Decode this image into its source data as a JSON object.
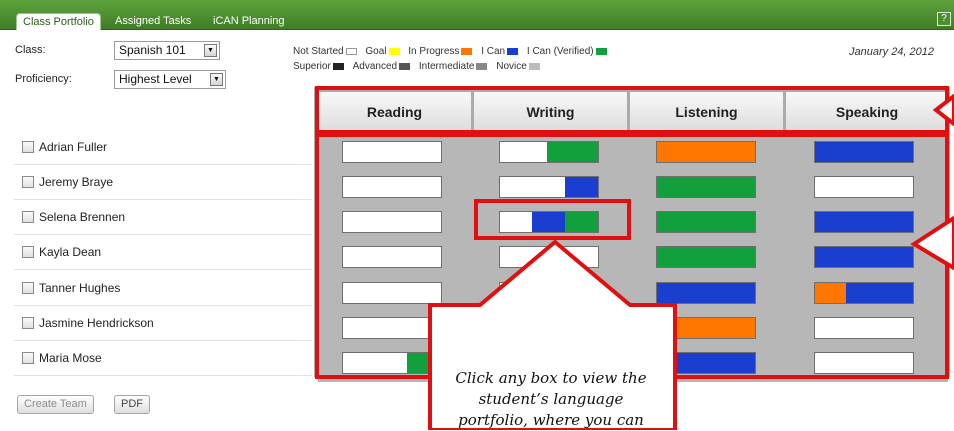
{
  "tabs": [
    {
      "label": "Class Portfolio",
      "active": true
    },
    {
      "label": "Assigned Tasks",
      "active": false
    },
    {
      "label": "iCAN Planning",
      "active": false
    }
  ],
  "help_label": "?",
  "filters": {
    "class_label": "Class:",
    "class_value": "Spanish 101",
    "proficiency_label": "Proficiency:",
    "proficiency_value": "Highest Level"
  },
  "legend": {
    "status": [
      {
        "label": "Not Started",
        "color": "#ffffff"
      },
      {
        "label": "Goal",
        "color": "#ffff00"
      },
      {
        "label": "In Progress",
        "color": "#ff7700"
      },
      {
        "label": "I Can",
        "color": "#1a3fd0"
      },
      {
        "label": "I Can (Verified)",
        "color": "#12a03c"
      }
    ],
    "level": [
      {
        "label": "Superior",
        "color": "#222222"
      },
      {
        "label": "Advanced",
        "color": "#555555"
      },
      {
        "label": "Intermediate",
        "color": "#888888"
      },
      {
        "label": "Novice",
        "color": "#bbbbbb"
      }
    ]
  },
  "date": "January 24, 2012",
  "columns": [
    "Reading",
    "Writing",
    "Listening",
    "Speaking"
  ],
  "students": [
    {
      "name": "Adrian Fuller",
      "cells": [
        [
          {
            "status": "Not Started",
            "fraction": 1
          }
        ],
        [
          {
            "status": "Not Started",
            "fraction": 0.48
          },
          {
            "status": "I Can (Verified)",
            "fraction": 0.52
          }
        ],
        [
          {
            "status": "In Progress",
            "fraction": 1
          }
        ],
        [
          {
            "status": "I Can",
            "fraction": 1
          }
        ]
      ]
    },
    {
      "name": "Jeremy Braye",
      "cells": [
        [
          {
            "status": "Not Started",
            "fraction": 1
          }
        ],
        [
          {
            "status": "Not Started",
            "fraction": 0.66
          },
          {
            "status": "I Can",
            "fraction": 0.34
          }
        ],
        [
          {
            "status": "I Can (Verified)",
            "fraction": 1
          }
        ],
        [
          {
            "status": "Not Started",
            "fraction": 1
          }
        ]
      ]
    },
    {
      "name": "Selena Brennen",
      "cells": [
        [
          {
            "status": "Not Started",
            "fraction": 1
          }
        ],
        [
          {
            "status": "Not Started",
            "fraction": 0.33
          },
          {
            "status": "I Can",
            "fraction": 0.33
          },
          {
            "status": "I Can (Verified)",
            "fraction": 0.34
          }
        ],
        [
          {
            "status": "I Can (Verified)",
            "fraction": 1
          }
        ],
        [
          {
            "status": "I Can",
            "fraction": 1
          }
        ]
      ]
    },
    {
      "name": "Kayla Dean",
      "cells": [
        [
          {
            "status": "Not Started",
            "fraction": 1
          }
        ],
        [
          {
            "status": "Not Started",
            "fraction": 1
          }
        ],
        [
          {
            "status": "I Can (Verified)",
            "fraction": 1
          }
        ],
        [
          {
            "status": "I Can",
            "fraction": 1
          }
        ]
      ]
    },
    {
      "name": "Tanner Hughes",
      "cells": [
        [
          {
            "status": "Not Started",
            "fraction": 1
          }
        ],
        [
          {
            "status": "Not Started",
            "fraction": 1
          }
        ],
        [
          {
            "status": "I Can",
            "fraction": 1
          }
        ],
        [
          {
            "status": "In Progress",
            "fraction": 0.32
          },
          {
            "status": "I Can",
            "fraction": 0.68
          }
        ]
      ]
    },
    {
      "name": "Jasmine Hendrickson",
      "cells": [
        [
          {
            "status": "Not Started",
            "fraction": 1
          }
        ],
        [
          {
            "status": "Not Started",
            "fraction": 0.9
          },
          {
            "status": "In Progress",
            "fraction": 0.1
          }
        ],
        [
          {
            "status": "In Progress",
            "fraction": 1
          }
        ],
        [
          {
            "status": "Not Started",
            "fraction": 1
          }
        ]
      ]
    },
    {
      "name": "Maria Mose",
      "cells": [
        [
          {
            "status": "Not Started",
            "fraction": 0.65
          },
          {
            "status": "I Can (Verified)",
            "fraction": 0.35
          }
        ],
        [
          {
            "status": "Not Started",
            "fraction": 1
          }
        ],
        [
          {
            "status": "I Can",
            "fraction": 1
          }
        ],
        [
          {
            "status": "Not Started",
            "fraction": 1
          }
        ]
      ]
    }
  ],
  "buttons": {
    "create_team": "Create Team",
    "pdf": "PDF"
  },
  "callout": {
    "line1": "Click any box to view the",
    "line2": "student’s language",
    "line3": "portfolio, where you can"
  },
  "annotation_color": "#e01010"
}
